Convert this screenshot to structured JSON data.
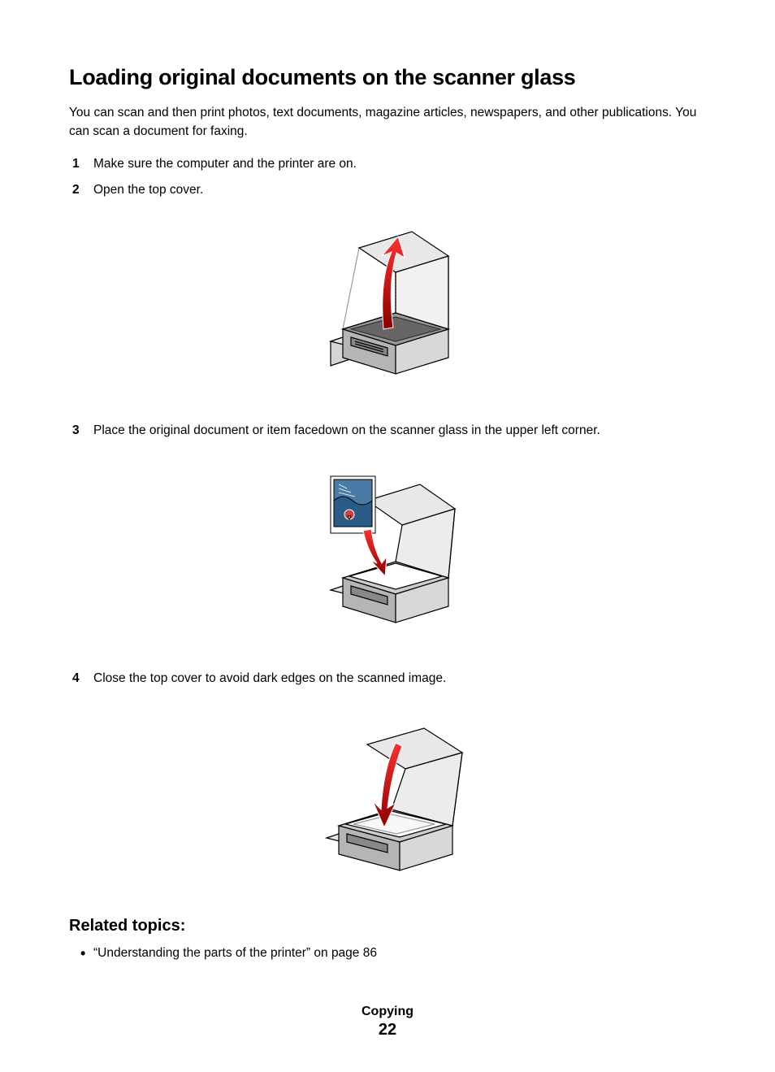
{
  "heading": "Loading original documents on the scanner glass",
  "intro": "You can scan and then print photos, text documents, magazine articles, newspapers, and other publications. You can scan a document for faxing.",
  "steps": [
    {
      "num": "1",
      "text": "Make sure the computer and the printer are on."
    },
    {
      "num": "2",
      "text": "Open the top cover."
    },
    {
      "num": "3",
      "text": "Place the original document or item facedown on the scanner glass in the upper left corner."
    },
    {
      "num": "4",
      "text": "Close the top cover to avoid dark edges on the scanned image."
    }
  ],
  "related_heading": "Related topics:",
  "related_items": [
    "“Understanding the parts of the printer” on page 86"
  ],
  "footer": {
    "section": "Copying",
    "page": "22"
  }
}
